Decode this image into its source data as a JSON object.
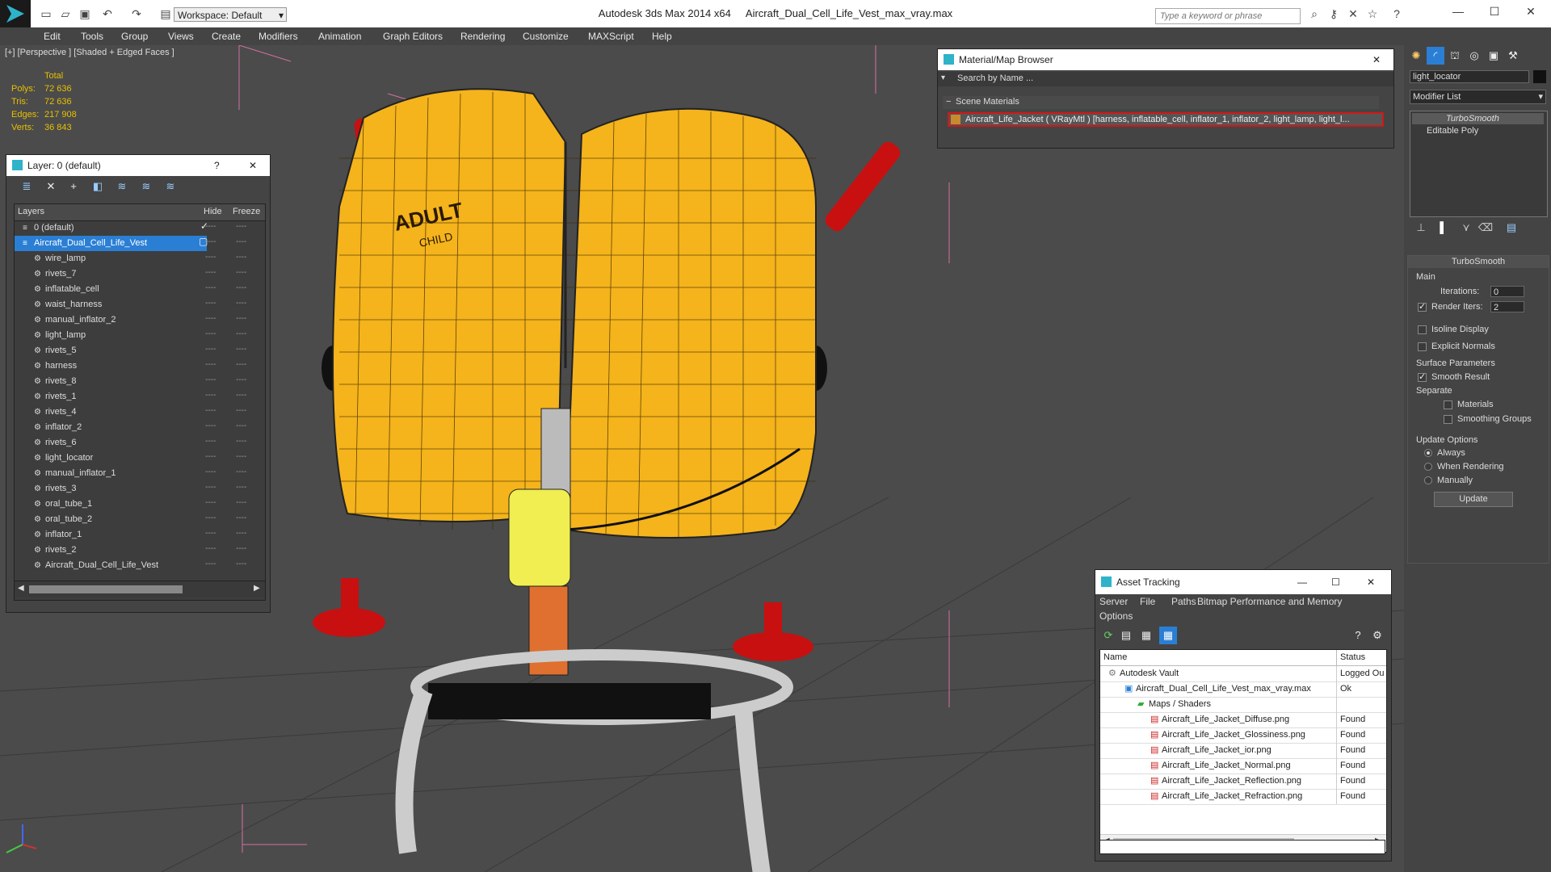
{
  "titlebar": {
    "app": "Autodesk 3ds Max  2014 x64",
    "file": "Aircraft_Dual_Cell_Life_Vest_max_vray.max",
    "workspace": "Workspace: Default",
    "search_placeholder": "Type a keyword or phrase"
  },
  "menu": [
    "Edit",
    "Tools",
    "Group",
    "Views",
    "Create",
    "Modifiers",
    "Animation",
    "Graph Editors",
    "Rendering",
    "Customize",
    "MAXScript",
    "Help"
  ],
  "viewport": {
    "label": "[+] [Perspective ] [Shaded + Edged Faces ]",
    "stats": {
      "total_label": "Total",
      "polys_label": "Polys:",
      "polys": "72 636",
      "tris_label": "Tris:",
      "tris": "72 636",
      "edges_label": "Edges:",
      "edges": "217 908",
      "verts_label": "Verts:",
      "verts": "36 843"
    },
    "vest_text": [
      "ADULT",
      "CHILD"
    ]
  },
  "layer_panel": {
    "title": "Layer: 0 (default)",
    "help": "?",
    "col_layers": "Layers",
    "col_hide": "Hide",
    "col_freeze": "Freeze",
    "rows": [
      "0 (default)",
      "Aircraft_Dual_Cell_Life_Vest",
      "wire_lamp",
      "rivets_7",
      "inflatable_cell",
      "waist_harness",
      "manual_inflator_2",
      "light_lamp",
      "rivets_5",
      "harness",
      "rivets_8",
      "rivets_1",
      "rivets_4",
      "inflator_2",
      "rivets_6",
      "light_locator",
      "manual_inflator_1",
      "rivets_3",
      "oral_tube_1",
      "oral_tube_2",
      "inflator_1",
      "rivets_2",
      "Aircraft_Dual_Cell_Life_Vest"
    ]
  },
  "material_browser": {
    "title": "Material/Map Browser",
    "search": "Search by Name ...",
    "section": "Scene Materials",
    "item": "Aircraft_Life_Jacket  ( VRayMtl ) [harness, inflatable_cell, inflator_1, inflator_2, light_lamp, light_l..."
  },
  "asset_tracking": {
    "title": "Asset Tracking",
    "menu": [
      "Server",
      "File",
      "Paths",
      "Bitmap Performance and Memory",
      "Options"
    ],
    "col_name": "Name",
    "col_status": "Status",
    "rows": [
      {
        "name": "Autodesk Vault",
        "status": "Logged Ou"
      },
      {
        "name": "Aircraft_Dual_Cell_Life_Vest_max_vray.max",
        "status": "Ok"
      },
      {
        "name": "Maps / Shaders",
        "status": ""
      },
      {
        "name": "Aircraft_Life_Jacket_Diffuse.png",
        "status": "Found"
      },
      {
        "name": "Aircraft_Life_Jacket_Glossiness.png",
        "status": "Found"
      },
      {
        "name": "Aircraft_Life_Jacket_ior.png",
        "status": "Found"
      },
      {
        "name": "Aircraft_Life_Jacket_Normal.png",
        "status": "Found"
      },
      {
        "name": "Aircraft_Life_Jacket_Reflection.png",
        "status": "Found"
      },
      {
        "name": "Aircraft_Life_Jacket_Refraction.png",
        "status": "Found"
      }
    ]
  },
  "command_panel": {
    "object_name": "light_locator",
    "modifier_list": "Modifier List",
    "stack": [
      "TurboSmooth",
      "Editable Poly"
    ],
    "rollout": "TurboSmooth",
    "main": "Main",
    "iterations_label": "Iterations:",
    "iterations": "0",
    "render_iters_label": "Render Iters:",
    "render_iters": "2",
    "isoline": "Isoline Display",
    "explicit": "Explicit Normals",
    "surface_params": "Surface Parameters",
    "smooth_result": "Smooth Result",
    "separate": "Separate",
    "materials": "Materials",
    "smoothing_groups": "Smoothing Groups",
    "update_options": "Update Options",
    "always": "Always",
    "when_rendering": "When Rendering",
    "manually": "Manually",
    "update": "Update"
  }
}
